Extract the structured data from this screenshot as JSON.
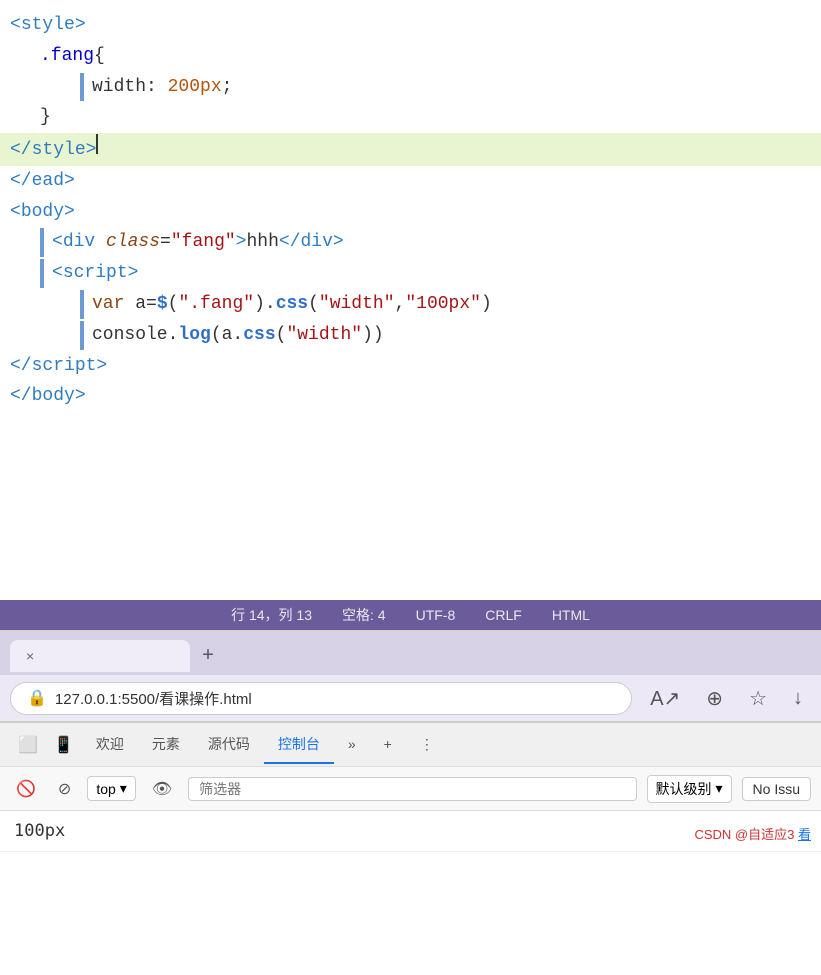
{
  "editor": {
    "lines": [
      {
        "id": "line1",
        "indent": "none",
        "highlighted": false,
        "parts": [
          {
            "type": "tag-bracket",
            "text": "<"
          },
          {
            "type": "tag-name",
            "text": "style"
          },
          {
            "type": "tag-bracket",
            "text": ">"
          }
        ]
      },
      {
        "id": "line2",
        "indent": "indent1",
        "highlighted": false,
        "parts": [
          {
            "type": "css-selector",
            "text": ".fang"
          },
          {
            "type": "text-content",
            "text": "{"
          }
        ]
      },
      {
        "id": "line3",
        "indent": "indent2",
        "highlighted": false,
        "hasBar": true,
        "parts": [
          {
            "type": "css-property",
            "text": "width: "
          },
          {
            "type": "css-value",
            "text": "200px"
          },
          {
            "type": "css-property",
            "text": ";"
          }
        ]
      },
      {
        "id": "line4",
        "indent": "indent1",
        "highlighted": false,
        "parts": [
          {
            "type": "text-content",
            "text": "}"
          }
        ]
      },
      {
        "id": "line5",
        "indent": "none",
        "highlighted": true,
        "cursor": true,
        "parts": [
          {
            "type": "tag-bracket",
            "text": "</"
          },
          {
            "type": "tag-name",
            "text": "style"
          },
          {
            "type": "tag-bracket",
            "text": ">"
          }
        ]
      },
      {
        "id": "line6",
        "indent": "none",
        "highlighted": false,
        "parts": [
          {
            "type": "tag-bracket",
            "text": "</"
          },
          {
            "type": "tag-name",
            "text": "ead"
          },
          {
            "type": "tag-bracket",
            "text": ">"
          }
        ]
      },
      {
        "id": "line7",
        "indent": "none",
        "highlighted": false,
        "parts": [
          {
            "type": "tag-bracket",
            "text": "<"
          },
          {
            "type": "tag-name",
            "text": "body"
          },
          {
            "type": "tag-bracket",
            "text": ">"
          }
        ]
      },
      {
        "id": "line8",
        "indent": "indent1",
        "highlighted": false,
        "hasBar": true,
        "parts": [
          {
            "type": "tag-bracket",
            "text": "<"
          },
          {
            "type": "tag-name",
            "text": "div"
          },
          {
            "type": "text-content",
            "text": " "
          },
          {
            "type": "attr-name",
            "text": "class"
          },
          {
            "type": "text-content",
            "text": "="
          },
          {
            "type": "attr-value",
            "text": "\"fang\""
          },
          {
            "type": "tag-bracket",
            "text": ">"
          },
          {
            "type": "text-content",
            "text": "hhh"
          },
          {
            "type": "tag-bracket",
            "text": "</"
          },
          {
            "type": "tag-name",
            "text": "div"
          },
          {
            "type": "tag-bracket",
            "text": ">"
          }
        ]
      },
      {
        "id": "line9",
        "indent": "indent1",
        "highlighted": false,
        "hasBar": true,
        "parts": [
          {
            "type": "tag-bracket",
            "text": "<"
          },
          {
            "type": "tag-name",
            "text": "script"
          },
          {
            "type": "tag-bracket",
            "text": ">"
          }
        ]
      },
      {
        "id": "line10",
        "indent": "indent2",
        "highlighted": false,
        "hasBar": true,
        "parts": [
          {
            "type": "js-var",
            "text": "var "
          },
          {
            "type": "text-content",
            "text": "a="
          },
          {
            "type": "js-method",
            "text": "$"
          },
          {
            "type": "text-content",
            "text": "("
          },
          {
            "type": "js-string",
            "text": "\".fang\""
          },
          {
            "type": "text-content",
            "text": ")."
          },
          {
            "type": "js-method",
            "text": "css"
          },
          {
            "type": "text-content",
            "text": "("
          },
          {
            "type": "js-string",
            "text": "\"width\""
          },
          {
            "type": "text-content",
            "text": ","
          },
          {
            "type": "js-string",
            "text": "\"100px\""
          },
          {
            "type": "text-content",
            "text": ")"
          }
        ]
      },
      {
        "id": "line11",
        "indent": "indent2",
        "highlighted": false,
        "hasBar": true,
        "parts": [
          {
            "type": "text-content",
            "text": "console."
          },
          {
            "type": "js-method",
            "text": "log"
          },
          {
            "type": "text-content",
            "text": "(a."
          },
          {
            "type": "js-method",
            "text": "css"
          },
          {
            "type": "text-content",
            "text": "("
          },
          {
            "type": "js-string",
            "text": "\"width\""
          },
          {
            "type": "text-content",
            "text": "))"
          }
        ]
      },
      {
        "id": "line12",
        "indent": "none",
        "highlighted": false,
        "parts": [
          {
            "type": "tag-bracket",
            "text": "</"
          },
          {
            "type": "tag-name",
            "text": "script"
          },
          {
            "type": "tag-bracket",
            "text": ">"
          }
        ]
      },
      {
        "id": "line13",
        "indent": "none",
        "highlighted": false,
        "parts": [
          {
            "type": "tag-bracket",
            "text": "</"
          },
          {
            "type": "tag-name",
            "text": "body"
          },
          {
            "type": "tag-bracket",
            "text": ">"
          }
        ]
      }
    ]
  },
  "statusBar": {
    "row": "行 14，列 13",
    "spaces": "空格: 4",
    "encoding": "UTF-8",
    "lineEnding": "CRLF",
    "language": "HTML"
  },
  "browser": {
    "tabTitle": "",
    "closeLabel": "×",
    "addTabLabel": "+",
    "addressBarValue": "127.0.0.1:5500/看课操作.html",
    "readingModeIcon": "A↗",
    "favoriteAddIcon": "⊕",
    "favoriteIcon": "☆",
    "downloadIcon": "↓"
  },
  "devtools": {
    "tabs": [
      {
        "id": "inspect",
        "label": "🔲",
        "isIcon": true
      },
      {
        "id": "device",
        "label": "📱",
        "isIcon": true
      },
      {
        "id": "welcome",
        "label": "欢迎"
      },
      {
        "id": "elements",
        "label": "元素"
      },
      {
        "id": "source",
        "label": "源代码"
      },
      {
        "id": "console",
        "label": "控制台",
        "active": true
      },
      {
        "id": "more",
        "label": "»"
      },
      {
        "id": "add",
        "label": "+"
      },
      {
        "id": "menu",
        "label": "⋮"
      }
    ],
    "toolbar": {
      "clearBtn": "🚫",
      "blockBtn": "⊘",
      "topLabel": "top",
      "topDropdown": "▾",
      "eyeBtn": "👁",
      "filterPlaceholder": "筛选器",
      "levelLabel": "默认级别",
      "levelDropdown": "▾",
      "noIssuesLabel": "No Issu"
    },
    "console": {
      "output": "100px"
    }
  },
  "watermark": {
    "text": "CSDN @自适应3",
    "linkText": "看"
  }
}
